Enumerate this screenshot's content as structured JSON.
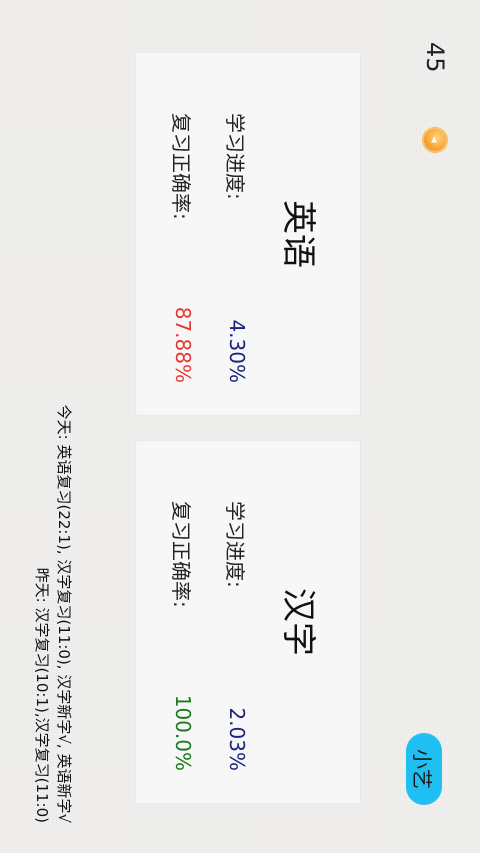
{
  "header": {
    "count": "45",
    "coin_icon": "coin-icon",
    "user_label": "小艺"
  },
  "cards": {
    "english": {
      "title": "英语",
      "progress_label": "学习进度:",
      "progress_value": "4.30%",
      "accuracy_label": "复习正确率:",
      "accuracy_value": "87.88%"
    },
    "hanzi": {
      "title": "汉字",
      "progress_label": "学习进度:",
      "progress_value": "2.03%",
      "accuracy_label": "复习正确率:",
      "accuracy_value": "100.0%"
    }
  },
  "footer": {
    "today": "今天: 英语复习(22:1), 汉字复习(11:0), 汉字新字√, 英语新字√",
    "yesterday": "昨天: 汉字复习(10:1),汉字复习(11:0)"
  },
  "colors": {
    "progress_value": "#1a237e",
    "accuracy_good": "#1b7a1b",
    "accuracy_bad": "#e53935",
    "user_button": "#1fbff2",
    "coin": "#f7a233"
  }
}
